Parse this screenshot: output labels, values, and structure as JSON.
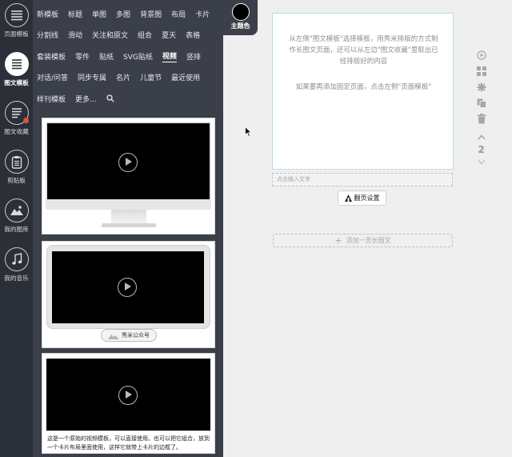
{
  "rail": [
    {
      "label": "页面模板",
      "icon": "menu-lines-icon",
      "active": false
    },
    {
      "label": "图文模板",
      "icon": "document-lines-icon",
      "active": true
    },
    {
      "label": "图文收藏",
      "icon": "favorite-doc-icon",
      "active": false
    },
    {
      "label": "剪贴板",
      "icon": "clipboard-icon",
      "active": false
    },
    {
      "label": "我的图库",
      "icon": "image-gallery-icon",
      "active": false
    },
    {
      "label": "我的音乐",
      "icon": "music-note-icon",
      "active": false
    }
  ],
  "categories": [
    [
      "新模板",
      "标题",
      "单图",
      "多图",
      "背景图",
      "布局",
      "卡片"
    ],
    [
      "分割线",
      "滑动",
      "关注和原文",
      "组合",
      "夏天",
      "表格"
    ],
    [
      "套装模板",
      "零件",
      "贴纸",
      "SVG贴纸",
      "视频",
      "竖排"
    ],
    [
      "对话/问答",
      "同步专属",
      "名片",
      "儿童节",
      "最近使用"
    ],
    [
      "样刊模板",
      "更多..."
    ]
  ],
  "active_category": "视频",
  "theme": {
    "label": "主题色",
    "color": "#000000"
  },
  "templates": {
    "card3_account": "秀米公众号",
    "card4_caption": "这是一个原始的视频模板，可以直接使用。也可以把它组合，放到一个卡片布局里面使用，这样它就带上卡片的边框了。"
  },
  "editor": {
    "hint_line1": "从左侧\"图文模板\"选择模板，用秀米排版的方式制作长图文页面，还可以从左边\"图文收藏\"里取出已经排版好的内容",
    "hint_line2": "如果要再添加固定页面，点击左侧\"页面模板\"",
    "text_placeholder": "点击输入文字",
    "flip_label": "翻页设置",
    "add_page_label": "添加一页长图文",
    "page_number": "2"
  },
  "colors": {
    "rail_bg": "#2b2f37",
    "panel_bg": "#3a3f49",
    "canvas_border": "#b9dcec"
  }
}
